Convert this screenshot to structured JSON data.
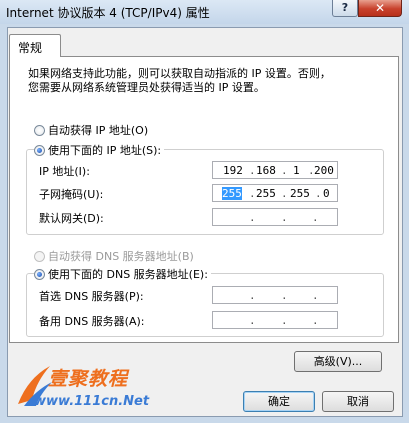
{
  "window": {
    "title": "Internet 协议版本 4 (TCP/IPv4) 属性",
    "help_glyph": "?",
    "close_glyph": "✕"
  },
  "tabs": [
    {
      "label": "常规",
      "selected": true
    }
  ],
  "description": {
    "line1": "如果网络支持此功能，则可以获取自动指派的 IP 设置。否则，",
    "line2": "您需要从网络系统管理员处获得适当的 IP 设置。"
  },
  "ip_section": {
    "auto_option": {
      "label": "自动获得 IP 地址(O)",
      "selected": false,
      "enabled": true
    },
    "manual_option": {
      "label": "使用下面的 IP 地址(S):",
      "selected": true,
      "enabled": true
    },
    "fields": [
      {
        "label": "IP 地址(I):",
        "octets": [
          "192",
          "168",
          "1",
          "200"
        ]
      },
      {
        "label": "子网掩码(U):",
        "octets": [
          "255",
          "255",
          "255",
          "0"
        ],
        "selected_octet": 0
      },
      {
        "label": "默认网关(D):",
        "octets": [
          "",
          "",
          "",
          ""
        ]
      }
    ]
  },
  "dns_section": {
    "auto_option": {
      "label": "自动获得 DNS 服务器地址(B)",
      "selected": false,
      "enabled": false
    },
    "manual_option": {
      "label": "使用下面的 DNS 服务器地址(E):",
      "selected": true,
      "enabled": true
    },
    "fields": [
      {
        "label": "首选 DNS 服务器(P):",
        "octets": [
          "",
          "",
          "",
          ""
        ]
      },
      {
        "label": "备用 DNS 服务器(A):",
        "octets": [
          "",
          "",
          "",
          ""
        ]
      }
    ]
  },
  "buttons": {
    "advanced": "高级(V)...",
    "ok": "确定",
    "cancel": "取消"
  },
  "watermark": {
    "brand": "壹聚教程",
    "url": "www.111cn.Net"
  },
  "colors": {
    "accent": "#3399ff",
    "close": "#c8412c",
    "watermark_orange": "#ee6f1e",
    "watermark_blue": "#3a7bd5"
  }
}
